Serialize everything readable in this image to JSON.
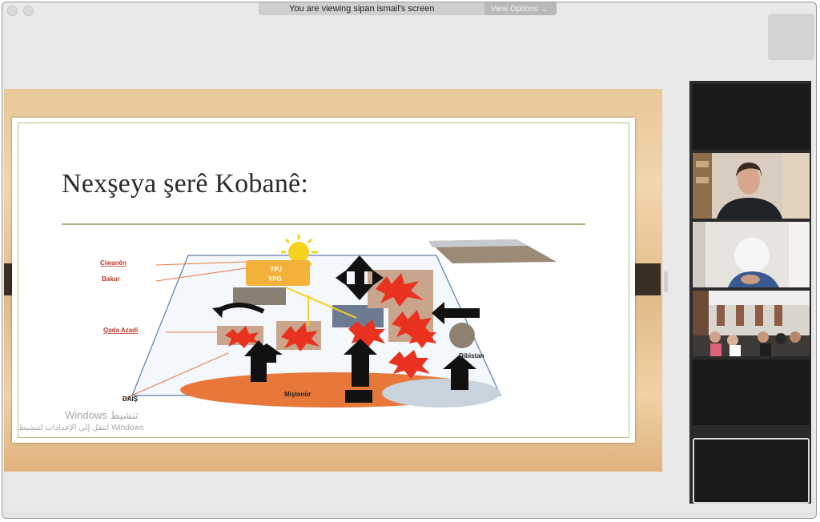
{
  "banner": {
    "message": "You are viewing sipan ismail's screen",
    "view_options": "View Options"
  },
  "slide": {
    "title": "Nexşeya şerê Kobanê:",
    "diagram": {
      "top_labels": [
        "YPJ",
        "YPG"
      ],
      "left_labels": [
        "Ciwanên",
        "Bakur",
        "Qada Azadî",
        "DAIŞ"
      ],
      "center_label": "Miştenûr",
      "right_label": "Dibistan"
    },
    "watermark": {
      "line1": "Windows تنشيط",
      "line2": "انتقل إلى الإعدادات لتنشيط Windows"
    }
  },
  "colors": {
    "accent_orange": "#e8783a",
    "blast_red": "#e8321f",
    "sun_yellow": "#f5d21d"
  },
  "icons": [
    "chevron-down-icon"
  ]
}
